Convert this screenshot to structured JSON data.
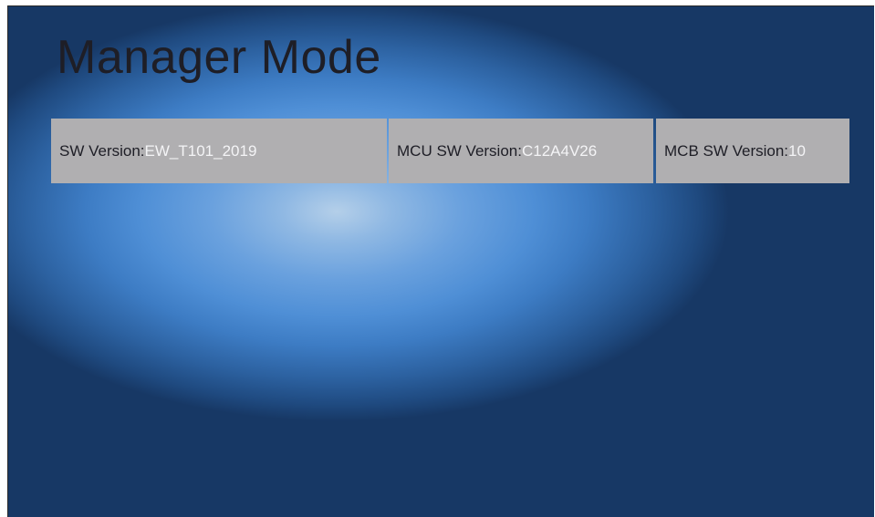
{
  "header": {
    "title": "Manager Mode"
  },
  "versions": {
    "sw": {
      "label": "SW Version:",
      "value": "EW_T101_2019"
    },
    "mcu": {
      "label": "MCU SW Version:",
      "value": "C12A4V26"
    },
    "mcb": {
      "label": "MCB SW Version:",
      "value": "10"
    }
  },
  "colors": {
    "background_center": "#b4cfe9",
    "background_edge": "#173865",
    "cell_background": "#b0afb1",
    "label_text": "#1e1e26",
    "value_text": "#f4f4f6"
  }
}
